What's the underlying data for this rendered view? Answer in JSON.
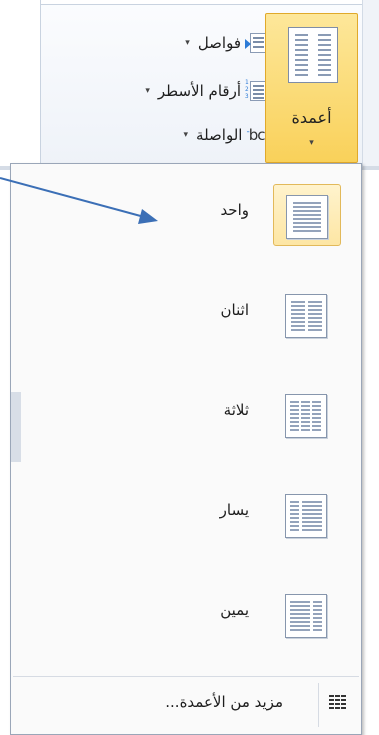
{
  "ribbon": {
    "breaks_label": "فواصل",
    "line_numbers_label": "أرقام الأسطر",
    "hyphenation_label": "الواصلة",
    "hyphenation_icon_text": "bc",
    "hyphenation_icon_sup": "a-",
    "caret": "▾",
    "columns_button_label": "أعمدة"
  },
  "columns_menu": {
    "items": [
      {
        "label": "واحد",
        "icon": "one-column-icon",
        "selected": true
      },
      {
        "label": "اثنان",
        "icon": "two-columns-icon",
        "selected": false
      },
      {
        "label": "ثلاثة",
        "icon": "three-columns-icon",
        "selected": false
      },
      {
        "label": "يسار",
        "icon": "left-column-icon",
        "selected": false
      },
      {
        "label": "يمين",
        "icon": "right-column-icon",
        "selected": false
      }
    ],
    "more_label": "مزيد من الأعمدة..."
  },
  "colors": {
    "selected_fill": "#fde6a4",
    "arrow": "#3b6fb6",
    "pressed_button": "#f9d15a"
  }
}
